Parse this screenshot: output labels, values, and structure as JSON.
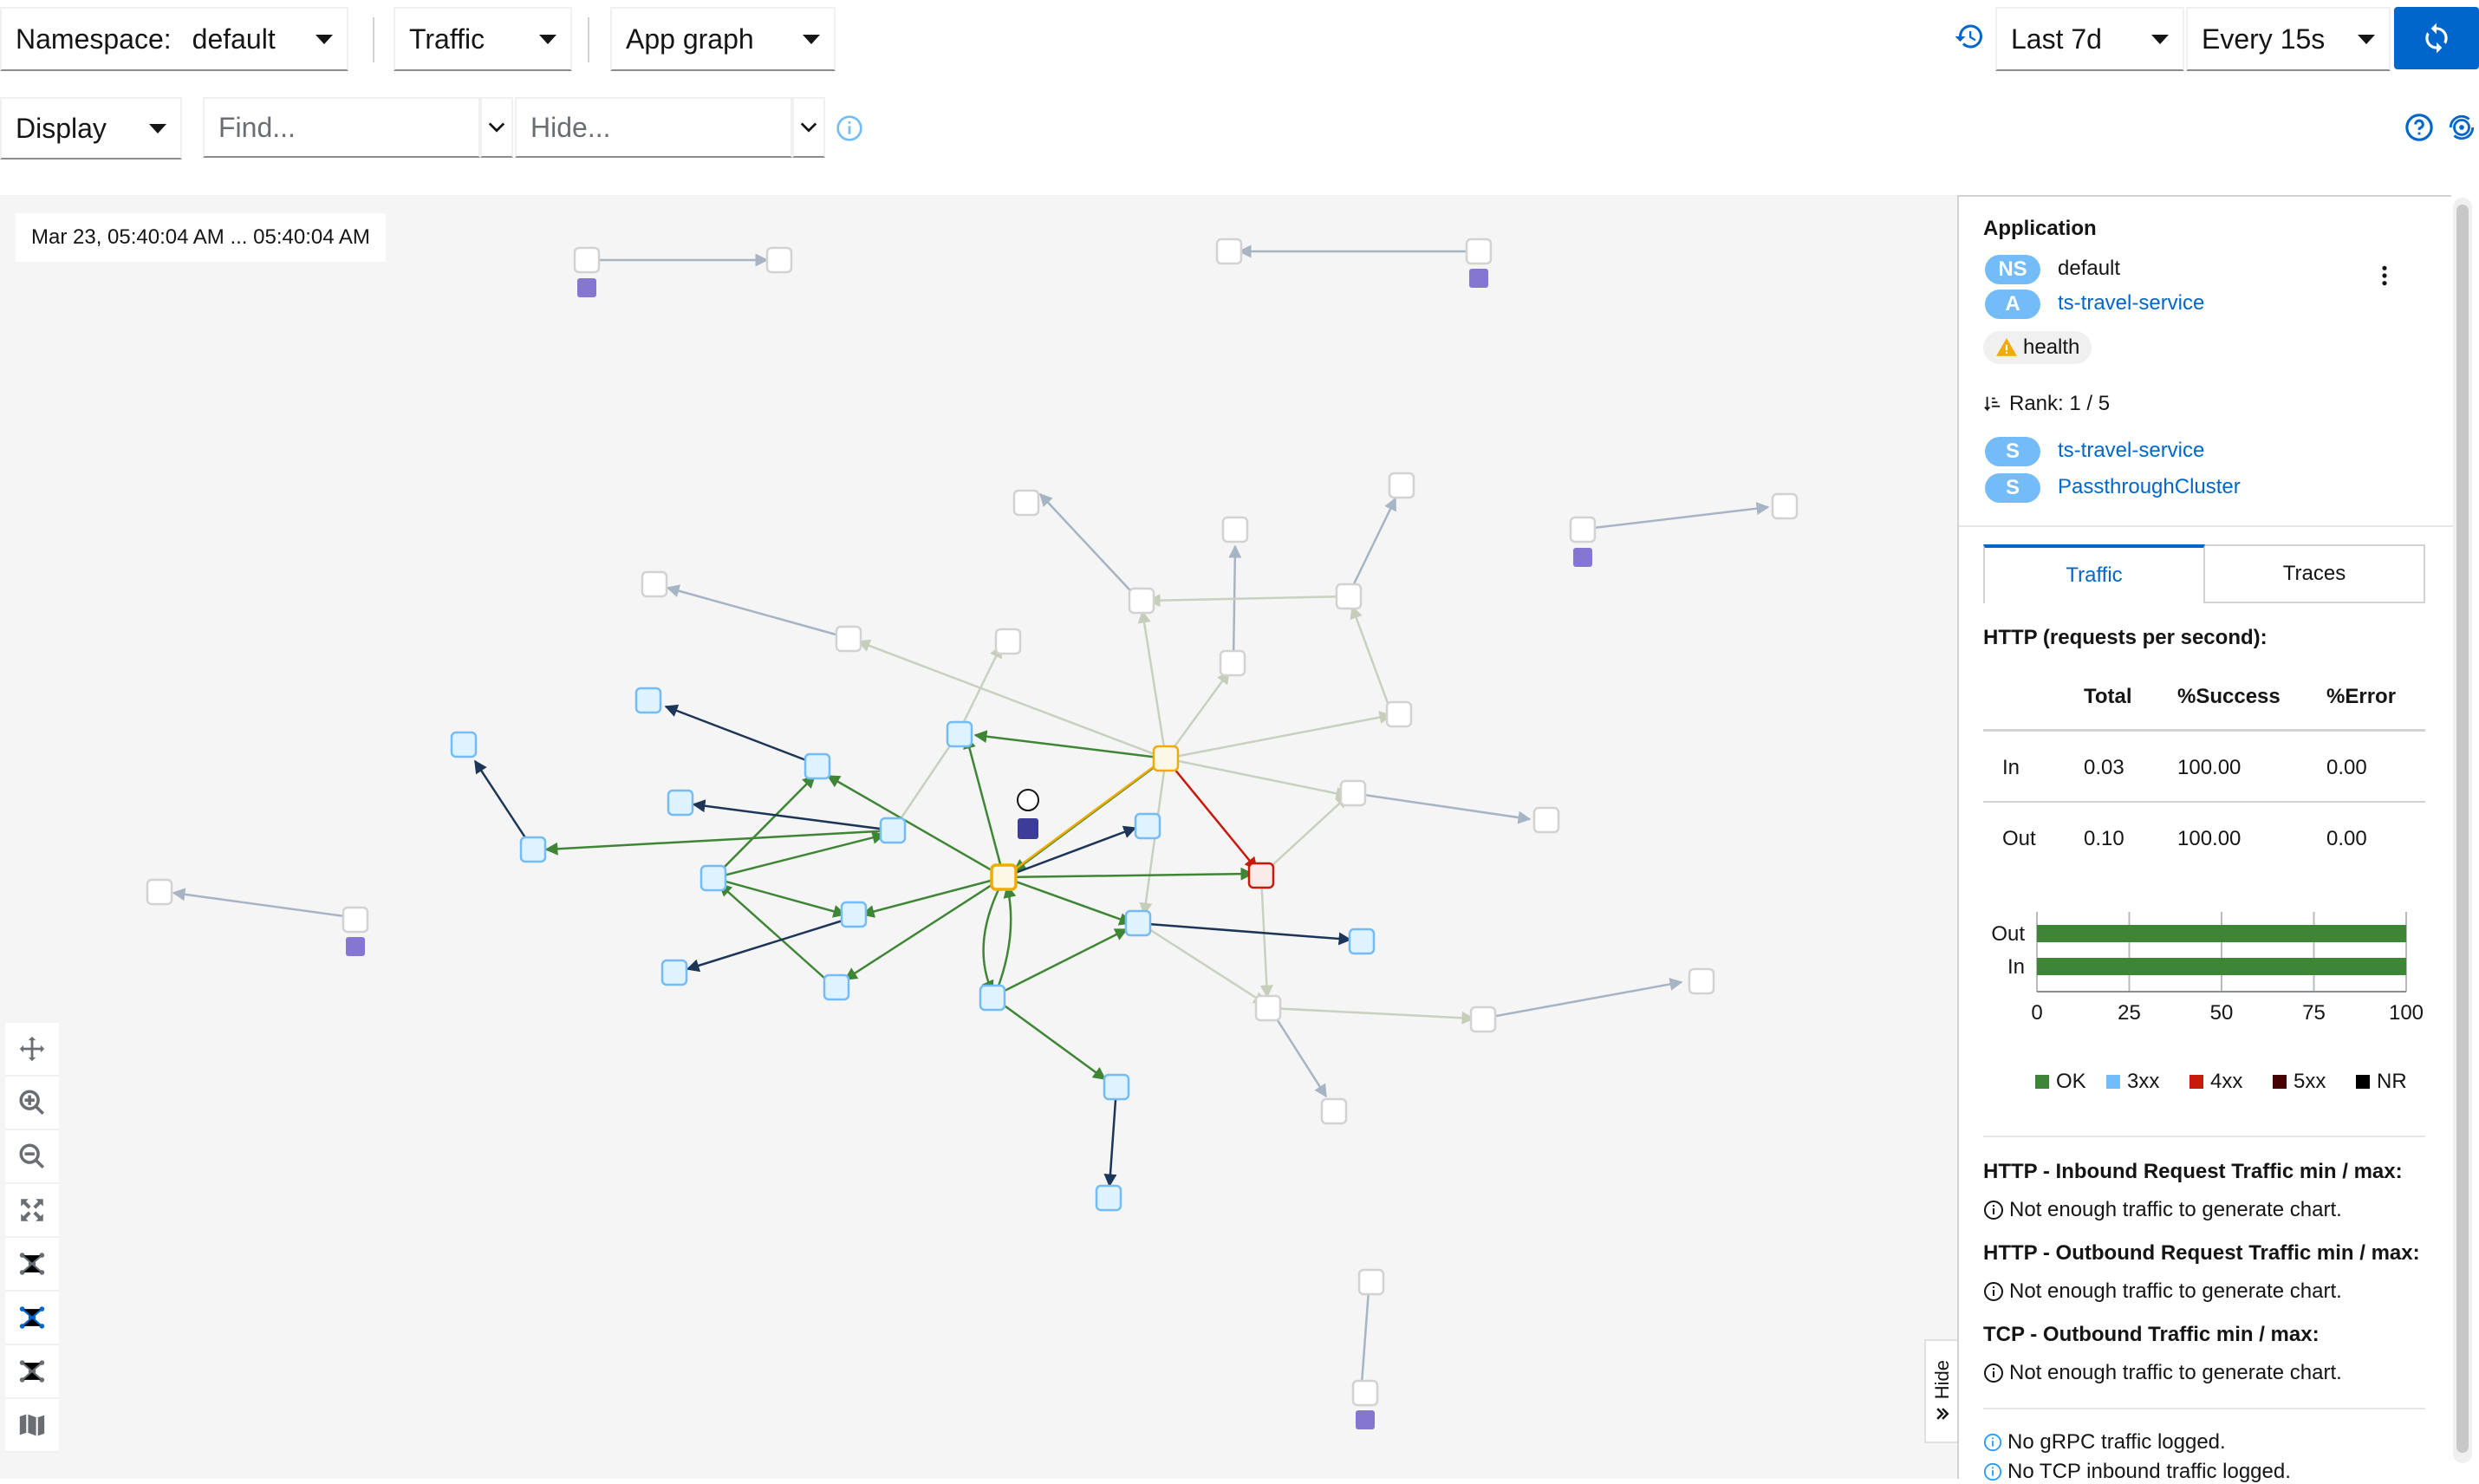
{
  "toolbar": {
    "namespace_label": "Namespace:",
    "namespace_value": "default",
    "traffic_label": "Traffic",
    "graph_type": "App graph",
    "duration": "Last 7d",
    "refresh_interval": "Every 15s",
    "display_label": "Display",
    "find_placeholder": "Find...",
    "hide_placeholder": "Hide..."
  },
  "graph": {
    "time_range": "Mar 23, 05:40:04 AM ... 05:40:04 AM",
    "hide_tab": "Hide"
  },
  "panel": {
    "heading": "Application",
    "ns_badge": "NS",
    "namespace": "default",
    "app_badge": "A",
    "app_name": "ts-travel-service",
    "health_label": "health",
    "rank": "Rank: 1 / 5",
    "services": [
      {
        "badge": "S",
        "name": "ts-travel-service"
      },
      {
        "badge": "S",
        "name": "PassthroughCluster"
      }
    ],
    "tabs": [
      "Traffic",
      "Traces"
    ],
    "http_title": "HTTP (requests per second):",
    "columns": [
      "Total",
      "%Success",
      "%Error"
    ],
    "rows": [
      {
        "dir": "In",
        "total": "0.03",
        "success": "100.00",
        "error": "0.00"
      },
      {
        "dir": "Out",
        "total": "0.10",
        "success": "100.00",
        "error": "0.00"
      }
    ],
    "inbound_title": "HTTP - Inbound Request Traffic min / max:",
    "outbound_title": "HTTP - Outbound Request Traffic min / max:",
    "tcp_title": "TCP - Outbound Traffic min / max:",
    "not_enough": "Not enough traffic to generate chart.",
    "grpc_note": "No gRPC traffic logged.",
    "tcp_inbound_note": "No TCP inbound traffic logged."
  },
  "chart_data": {
    "type": "bar",
    "orientation": "horizontal",
    "stacked": true,
    "categories": [
      "Out",
      "In"
    ],
    "series": [
      {
        "name": "OK",
        "color": "#3e8635",
        "values": [
          100,
          100
        ]
      },
      {
        "name": "3xx",
        "color": "#73bcf7",
        "values": [
          0,
          0
        ]
      },
      {
        "name": "4xx",
        "color": "#c9190b",
        "values": [
          0,
          0
        ]
      },
      {
        "name": "5xx",
        "color": "#470000",
        "values": [
          0,
          0
        ]
      },
      {
        "name": "NR",
        "color": "#000000",
        "values": [
          0,
          0
        ]
      }
    ],
    "xticks": [
      "0",
      "25",
      "50",
      "75",
      "100"
    ],
    "xlim": [
      0,
      100
    ],
    "grid": true,
    "legend": "bottom"
  },
  "colors": {
    "accent": "#0066cc",
    "ok_edge": "#3e8635",
    "dark_edge": "#1d3557",
    "error_edge": "#c9190b",
    "warn_edge": "#f0ab00",
    "idle_edge": "#c8d0c0",
    "node_blue": "#def3ff",
    "node_blue_border": "#73bcf7"
  }
}
